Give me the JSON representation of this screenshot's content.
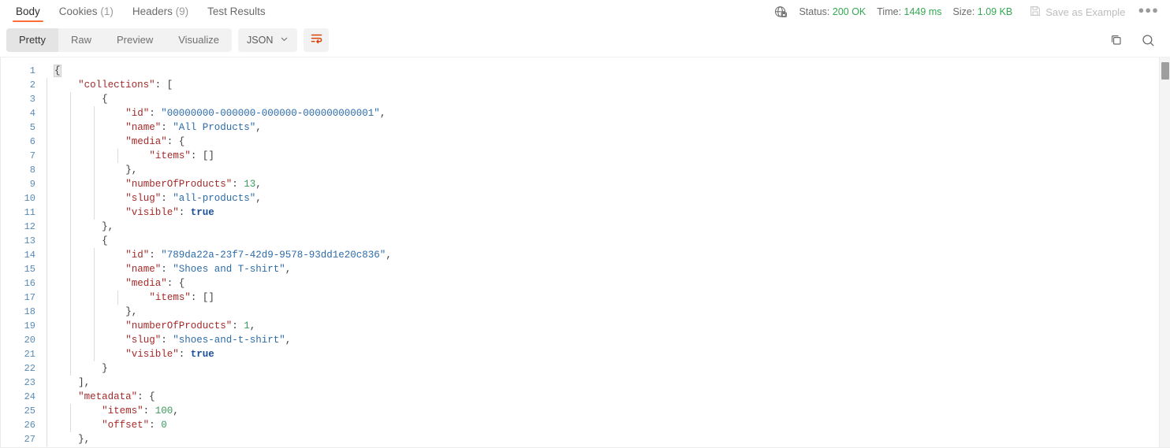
{
  "response_tabs": [
    {
      "label": "Body",
      "count": "",
      "active": true
    },
    {
      "label": "Cookies",
      "count": "(1)",
      "active": false
    },
    {
      "label": "Headers",
      "count": "(9)",
      "active": false
    },
    {
      "label": "Test Results",
      "count": "",
      "active": false
    }
  ],
  "status_meta": {
    "security_icon": "globe-lock-icon",
    "status_label": "Status:",
    "status_value": "200 OK",
    "time_label": "Time:",
    "time_value": "1449 ms",
    "size_label": "Size:",
    "size_value": "1.09 KB",
    "save_as_example": "Save as Example",
    "save_icon": "floppy-disk-icon",
    "more_menu": "●●●"
  },
  "toolbar": {
    "view_modes": [
      {
        "label": "Pretty",
        "active": true
      },
      {
        "label": "Raw",
        "active": false
      },
      {
        "label": "Preview",
        "active": false
      },
      {
        "label": "Visualize",
        "active": false
      }
    ],
    "format_select": "JSON",
    "format_chevron": "chevron-down-icon",
    "wrap_icon": "word-wrap-icon",
    "copy_icon": "copy-icon",
    "search_icon": "search-icon"
  },
  "accent_color": "#ff6c37",
  "code": {
    "language": "json",
    "lines": [
      {
        "no": 1,
        "indent": 0,
        "tokens": [
          {
            "t": "{",
            "c": "p hl"
          }
        ]
      },
      {
        "no": 2,
        "indent": 1,
        "tokens": [
          {
            "t": "\"collections\"",
            "c": "k"
          },
          {
            "t": ": [",
            "c": "p"
          }
        ]
      },
      {
        "no": 3,
        "indent": 2,
        "tokens": [
          {
            "t": "{",
            "c": "p"
          }
        ]
      },
      {
        "no": 4,
        "indent": 3,
        "tokens": [
          {
            "t": "\"id\"",
            "c": "k"
          },
          {
            "t": ": ",
            "c": "p"
          },
          {
            "t": "\"00000000-000000-000000-000000000001\"",
            "c": "s"
          },
          {
            "t": ",",
            "c": "p"
          }
        ]
      },
      {
        "no": 5,
        "indent": 3,
        "tokens": [
          {
            "t": "\"name\"",
            "c": "k"
          },
          {
            "t": ": ",
            "c": "p"
          },
          {
            "t": "\"All Products\"",
            "c": "s"
          },
          {
            "t": ",",
            "c": "p"
          }
        ]
      },
      {
        "no": 6,
        "indent": 3,
        "tokens": [
          {
            "t": "\"media\"",
            "c": "k"
          },
          {
            "t": ": {",
            "c": "p"
          }
        ]
      },
      {
        "no": 7,
        "indent": 4,
        "tokens": [
          {
            "t": "\"items\"",
            "c": "k"
          },
          {
            "t": ": []",
            "c": "p"
          }
        ]
      },
      {
        "no": 8,
        "indent": 3,
        "tokens": [
          {
            "t": "},",
            "c": "p"
          }
        ]
      },
      {
        "no": 9,
        "indent": 3,
        "tokens": [
          {
            "t": "\"numberOfProducts\"",
            "c": "k"
          },
          {
            "t": ": ",
            "c": "p"
          },
          {
            "t": "13",
            "c": "n"
          },
          {
            "t": ",",
            "c": "p"
          }
        ]
      },
      {
        "no": 10,
        "indent": 3,
        "tokens": [
          {
            "t": "\"slug\"",
            "c": "k"
          },
          {
            "t": ": ",
            "c": "p"
          },
          {
            "t": "\"all-products\"",
            "c": "s"
          },
          {
            "t": ",",
            "c": "p"
          }
        ]
      },
      {
        "no": 11,
        "indent": 3,
        "tokens": [
          {
            "t": "\"visible\"",
            "c": "k"
          },
          {
            "t": ": ",
            "c": "p"
          },
          {
            "t": "true",
            "c": "b"
          }
        ]
      },
      {
        "no": 12,
        "indent": 2,
        "tokens": [
          {
            "t": "},",
            "c": "p"
          }
        ]
      },
      {
        "no": 13,
        "indent": 2,
        "tokens": [
          {
            "t": "{",
            "c": "p"
          }
        ]
      },
      {
        "no": 14,
        "indent": 3,
        "tokens": [
          {
            "t": "\"id\"",
            "c": "k"
          },
          {
            "t": ": ",
            "c": "p"
          },
          {
            "t": "\"789da22a-23f7-42d9-9578-93dd1e20c836\"",
            "c": "s"
          },
          {
            "t": ",",
            "c": "p"
          }
        ]
      },
      {
        "no": 15,
        "indent": 3,
        "tokens": [
          {
            "t": "\"name\"",
            "c": "k"
          },
          {
            "t": ": ",
            "c": "p"
          },
          {
            "t": "\"Shoes and T-shirt\"",
            "c": "s"
          },
          {
            "t": ",",
            "c": "p"
          }
        ]
      },
      {
        "no": 16,
        "indent": 3,
        "tokens": [
          {
            "t": "\"media\"",
            "c": "k"
          },
          {
            "t": ": {",
            "c": "p"
          }
        ]
      },
      {
        "no": 17,
        "indent": 4,
        "tokens": [
          {
            "t": "\"items\"",
            "c": "k"
          },
          {
            "t": ": []",
            "c": "p"
          }
        ]
      },
      {
        "no": 18,
        "indent": 3,
        "tokens": [
          {
            "t": "},",
            "c": "p"
          }
        ]
      },
      {
        "no": 19,
        "indent": 3,
        "tokens": [
          {
            "t": "\"numberOfProducts\"",
            "c": "k"
          },
          {
            "t": ": ",
            "c": "p"
          },
          {
            "t": "1",
            "c": "n"
          },
          {
            "t": ",",
            "c": "p"
          }
        ]
      },
      {
        "no": 20,
        "indent": 3,
        "tokens": [
          {
            "t": "\"slug\"",
            "c": "k"
          },
          {
            "t": ": ",
            "c": "p"
          },
          {
            "t": "\"shoes-and-t-shirt\"",
            "c": "s"
          },
          {
            "t": ",",
            "c": "p"
          }
        ]
      },
      {
        "no": 21,
        "indent": 3,
        "tokens": [
          {
            "t": "\"visible\"",
            "c": "k"
          },
          {
            "t": ": ",
            "c": "p"
          },
          {
            "t": "true",
            "c": "b"
          }
        ]
      },
      {
        "no": 22,
        "indent": 2,
        "tokens": [
          {
            "t": "}",
            "c": "p"
          }
        ]
      },
      {
        "no": 23,
        "indent": 1,
        "tokens": [
          {
            "t": "],",
            "c": "p"
          }
        ]
      },
      {
        "no": 24,
        "indent": 1,
        "tokens": [
          {
            "t": "\"metadata\"",
            "c": "k"
          },
          {
            "t": ": {",
            "c": "p"
          }
        ]
      },
      {
        "no": 25,
        "indent": 2,
        "tokens": [
          {
            "t": "\"items\"",
            "c": "k"
          },
          {
            "t": ": ",
            "c": "p"
          },
          {
            "t": "100",
            "c": "n"
          },
          {
            "t": ",",
            "c": "p"
          }
        ]
      },
      {
        "no": 26,
        "indent": 2,
        "tokens": [
          {
            "t": "\"offset\"",
            "c": "k"
          },
          {
            "t": ": ",
            "c": "p"
          },
          {
            "t": "0",
            "c": "n"
          }
        ]
      },
      {
        "no": 27,
        "indent": 1,
        "tokens": [
          {
            "t": "},",
            "c": "p"
          }
        ]
      }
    ]
  }
}
